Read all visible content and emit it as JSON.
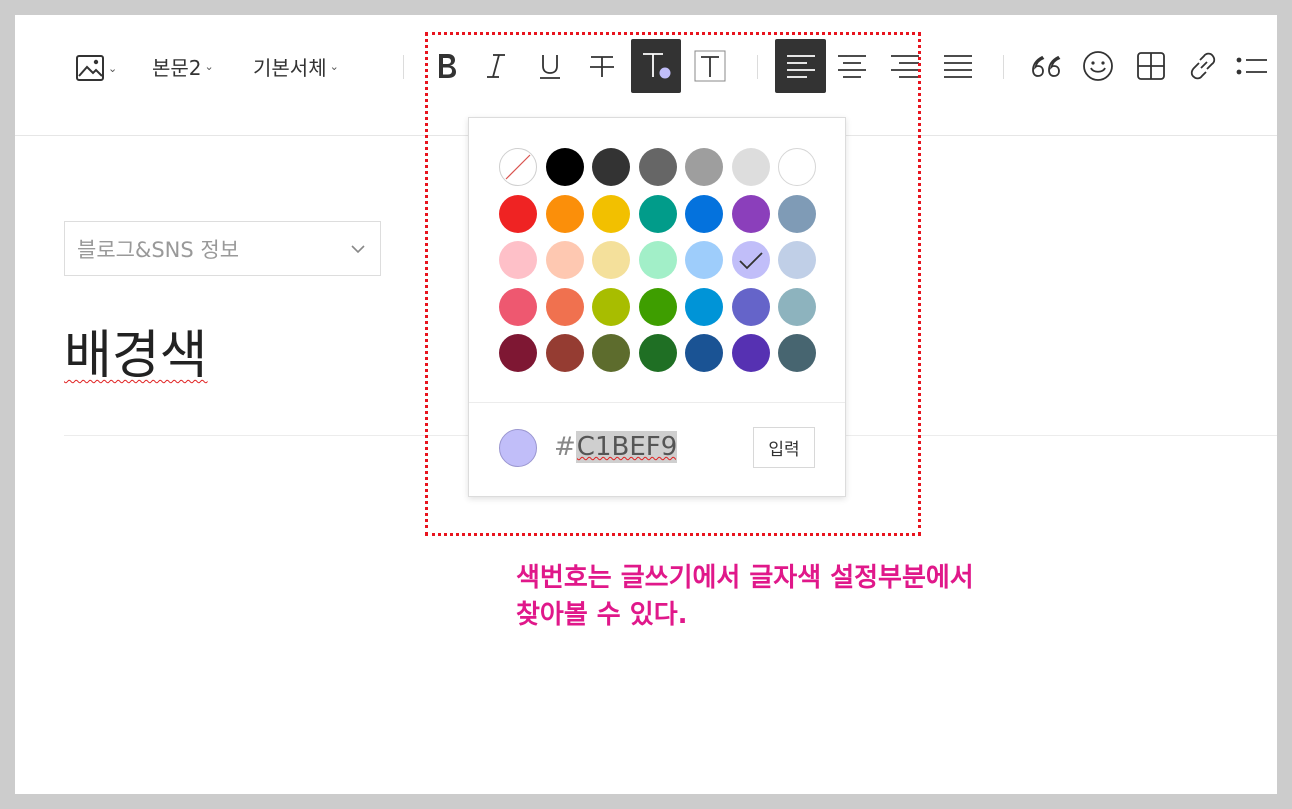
{
  "toolbar": {
    "paragraph_style": "본문2",
    "font_family": "기본서체",
    "chevron": "⌄",
    "text_color_marker": "#c1bef9"
  },
  "sidebar_select": {
    "label": "블로그&SNS 정보"
  },
  "document": {
    "title": "배경색"
  },
  "palette": {
    "rows": [
      [
        "none",
        "#000000",
        "#333333",
        "#666666",
        "#9e9e9e",
        "#dddddd",
        "#ffffff"
      ],
      [
        "#ef2323",
        "#fb8f0a",
        "#f2c000",
        "#019c8a",
        "#0472dd",
        "#8b3fbb",
        "#7f9bb6"
      ],
      [
        "#fec0c8",
        "#fec8b1",
        "#f4e09b",
        "#a2efc8",
        "#9ecdfb",
        "#c1bef9",
        "#c0cfe7"
      ],
      [
        "#ee5870",
        "#f0714f",
        "#a8bd00",
        "#3e9e00",
        "#0094d7",
        "#6564c9",
        "#8db3be"
      ],
      [
        "#7e1733",
        "#953c32",
        "#5d6c2d",
        "#1f6f24",
        "#1a5394",
        "#5631b2",
        "#476570"
      ]
    ],
    "selected": "#c1bef9",
    "hash": "#",
    "hex_value": "C1BEF9",
    "apply_label": "입력"
  },
  "annotation": {
    "line1": "색번호는 글쓰기에서 글자색 설정부분에서",
    "line2": "찾아볼 수 있다."
  }
}
